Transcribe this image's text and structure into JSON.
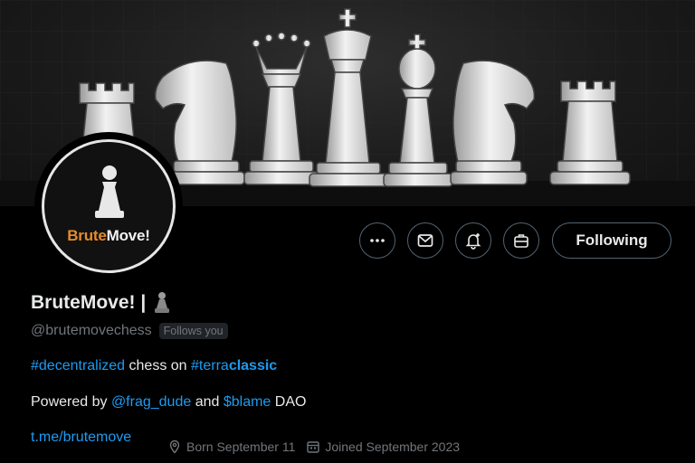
{
  "profile": {
    "avatar_brand_part1": "Brute",
    "avatar_brand_part2": "Move!",
    "display_name": "BruteMove! |",
    "handle": "@brutemovechess",
    "follows_you": "Follows you",
    "bio": {
      "line1": {
        "hashtag1": "#decentralized",
        "text1": " chess on ",
        "hashtag2_a": "#terra",
        "hashtag2_b": "classic"
      },
      "line2": {
        "text1": "Powered by ",
        "mention": "@frag_dude",
        "text2": " and ",
        "cashtag": "$blame",
        "text3": " DAO"
      }
    },
    "website": "t.me/brutemove",
    "born": "Born September 11",
    "joined": "Joined September 2023"
  },
  "actions": {
    "more_icon": "more-icon",
    "message_icon": "message-icon",
    "notify_icon": "notification-bell-icon",
    "subscribe_icon": "briefcase-icon",
    "following_label": "Following"
  },
  "colors": {
    "link": "#1d9bf0",
    "brand_orange": "#e88a2a",
    "secondary_text": "#71767b",
    "border": "#536471"
  }
}
